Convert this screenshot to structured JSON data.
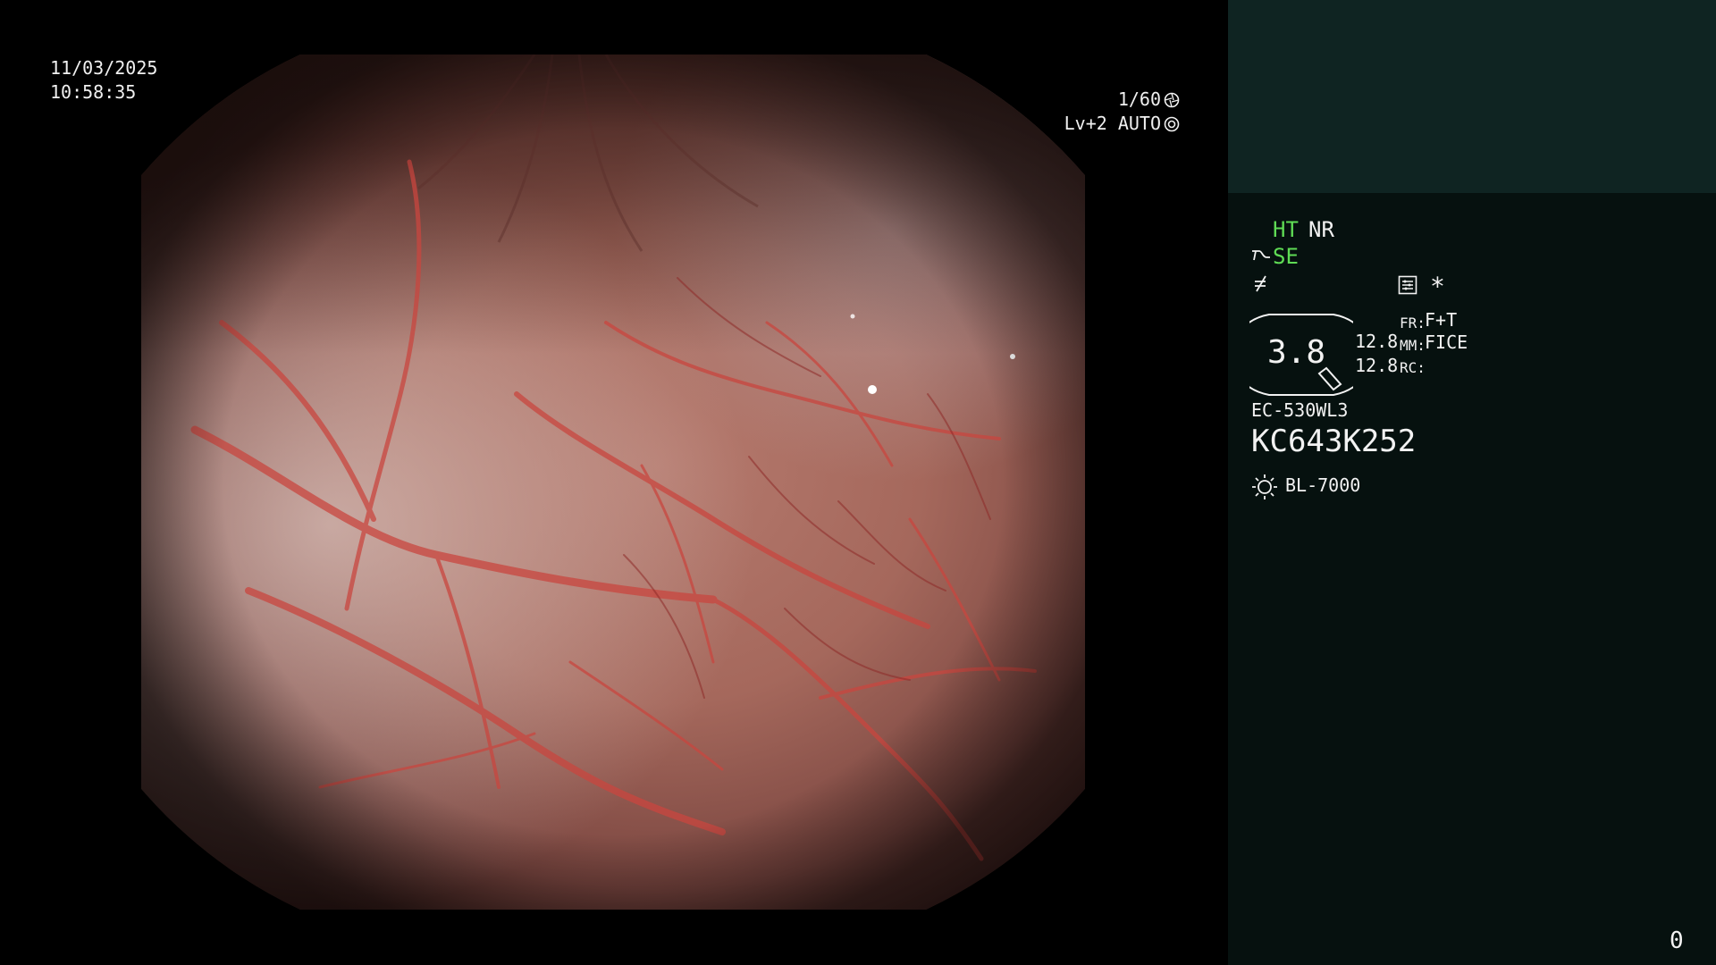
{
  "overlay": {
    "date": "11/03/2025",
    "time": "10:58:35",
    "shutter": "1/60",
    "shutter_icon": "shutter-icon",
    "iris": "Lv+2 AUTO",
    "iris_icon": "iris-icon"
  },
  "panel": {
    "ht": "HT",
    "nr": "NR",
    "se": "SE",
    "se_icon": "structure-enhancement-icon",
    "fx_icon": "not-equal-icon",
    "menu_icon": "settings-list-icon",
    "star": "*",
    "gauge_value": "3.8",
    "zoom_values": [
      "12.8",
      "12.8"
    ],
    "fr_label": "FR:",
    "fr_value": "F+T",
    "mm_label": "MM:",
    "mm_value": "FICE",
    "rc_label": "RC:",
    "scope_model": "EC-530WL3",
    "serial_number": "KC643K252",
    "light_icon": "light-source-icon",
    "light_source": "BL-7000",
    "counter": "0"
  },
  "colors": {
    "panel_top": "#0f2422",
    "panel_bottom": "#06110f",
    "status_green": "#5fdc55",
    "text": "#f2f2f2"
  }
}
